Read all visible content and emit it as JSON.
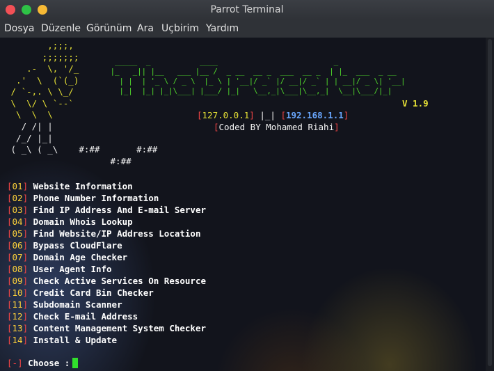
{
  "window": {
    "title": "Parrot Terminal"
  },
  "menubar": {
    "items": [
      "Dosya",
      "Düzenle",
      "Görünüm",
      "Ara",
      "Uçbirim",
      "Yardım"
    ]
  },
  "banner": {
    "ascii_left_top": "        ,;;;,\n       ;;;;;;;\n    .-  \\, '/_\n  .'  \\  (`(_)\n / `-,. \\ \\_/\n \\  \\/ \\ `--`\n  \\  \\  \\",
    "ascii_left_bottom": "   / /| |\n  /_/ |_|\n ( _\\ ( _\\    #:##       #:##\n                    #:##",
    "logo": "       _____  _           ____                          _\n      |_   _|| |__   ___ |__ /  _ __  __ _  ___  __ _  | |_  ___  _ __\n        | |  | '_ \\ / _ \\  |_ \\ | '__|/ _` |/ __|/ _` | | __|/ _ \\| '__|\n        |_|  |_| |_|\\___| |___/ |_|   \\__,_|\\___|\\__,_|  \\__|\\___/|_|",
    "version": "V 1.9",
    "ip_local": "127.0.0.1",
    "ip_separator": "|_|",
    "ip_public": "192.168.1.1",
    "credit": "Coded BY Mohamed Riahi"
  },
  "menu": [
    {
      "num": "01",
      "label": "Website Information"
    },
    {
      "num": "02",
      "label": "Phone Number Information"
    },
    {
      "num": "03",
      "label": "Find IP Address And E-mail Server"
    },
    {
      "num": "04",
      "label": "Domain Whois Lookup"
    },
    {
      "num": "05",
      "label": "Find Website/IP Address Location"
    },
    {
      "num": "06",
      "label": "Bypass CloudFlare"
    },
    {
      "num": "07",
      "label": "Domain Age Checker"
    },
    {
      "num": "08",
      "label": "User Agent Info"
    },
    {
      "num": "09",
      "label": "Check Active Services On Resource"
    },
    {
      "num": "10",
      "label": "Credit Card Bin Checker"
    },
    {
      "num": "11",
      "label": "Subdomain Scanner"
    },
    {
      "num": "12",
      "label": "Check E-mail Address"
    },
    {
      "num": "13",
      "label": "Content Management System Checker"
    },
    {
      "num": "14",
      "label": "Install & Update"
    }
  ],
  "prompt": {
    "marker": "-",
    "text": "Choose :"
  },
  "colors": {
    "accent_green": "#31e02c",
    "bracket_red": "#f24545",
    "number_yellow": "#ffd23a"
  }
}
